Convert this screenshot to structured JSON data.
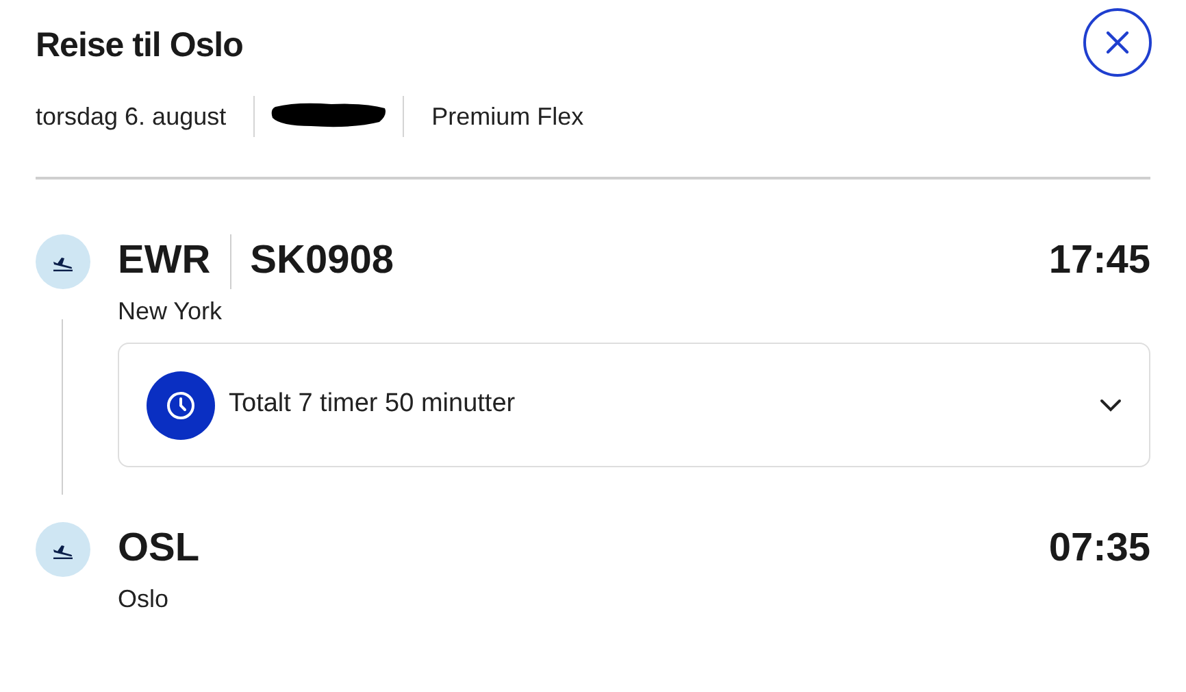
{
  "title": "Reise til Oslo",
  "meta": {
    "date": "torsdag 6. august",
    "booking_reference_redacted": true,
    "fare": "Premium Flex"
  },
  "departure": {
    "code": "EWR",
    "flight": "SK0908",
    "city": "New York",
    "time": "17:45"
  },
  "duration": {
    "text": "Totalt 7 timer 50 minutter",
    "expanded": false
  },
  "arrival": {
    "code": "OSL",
    "city": "Oslo",
    "time": "07:35"
  }
}
